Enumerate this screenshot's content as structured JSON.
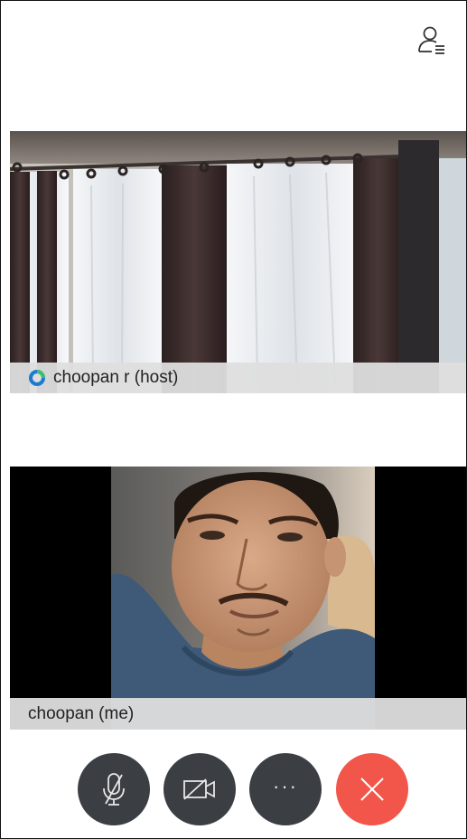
{
  "host_tile": {
    "name": "choopan r (host)",
    "badge_icon": "host-badge-icon"
  },
  "self_tile": {
    "name": "choopan (me)"
  },
  "controls": {
    "more_label": "···",
    "mute_icon": "mic-off-icon",
    "video_icon": "video-off-icon",
    "leave_icon": "close-icon"
  },
  "colors": {
    "leave_button": "#f2564a",
    "control_button": "#3b3f44",
    "name_bar": "#dedede"
  }
}
